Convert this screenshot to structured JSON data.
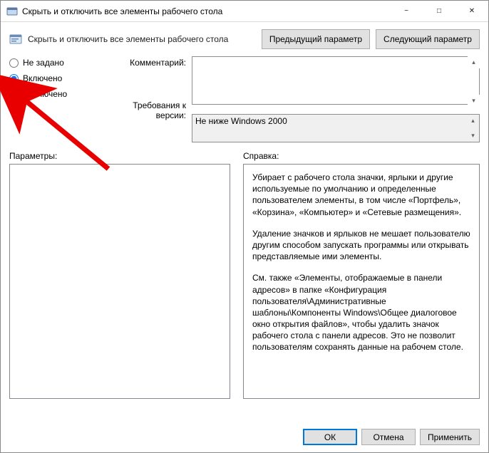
{
  "window": {
    "title": "Скрыть и отключить все элементы рабочего стола"
  },
  "toolbar": {
    "policy_label": "Скрыть и отключить все элементы рабочего стола",
    "prev_btn": "Предыдущий параметр",
    "next_btn": "Следующий параметр"
  },
  "state": {
    "opts": {
      "not_configured": "Не задано",
      "enabled": "Включено",
      "disabled": "Отключено"
    },
    "selected": "enabled"
  },
  "labels": {
    "comment": "Комментарий:",
    "requirements": "Требования к версии:",
    "options": "Параметры:",
    "help": "Справка:"
  },
  "fields": {
    "comment": "",
    "requirements": "Не ниже Windows 2000"
  },
  "help": {
    "p1": "Убирает с рабочего стола значки, ярлыки и другие используемые по умолчанию и определенные пользователем элементы, в том числе «Портфель», «Корзина», «Компьютер» и «Сетевые размещения».",
    "p2": "Удаление значков и ярлыков не мешает пользователю другим способом запускать программы или открывать представляемые ими элементы.",
    "p3": "См. также «Элементы, отображаемые в панели адресов» в папке «Конфигурация пользователя\\Административные шаблоны\\Компоненты Windows\\Общее диалоговое окно открытия файлов», чтобы удалить значок рабочего стола с панели адресов. Это не позволит пользователям сохранять данные на рабочем столе."
  },
  "footer": {
    "ok": "ОК",
    "cancel": "Отмена",
    "apply": "Применить"
  }
}
